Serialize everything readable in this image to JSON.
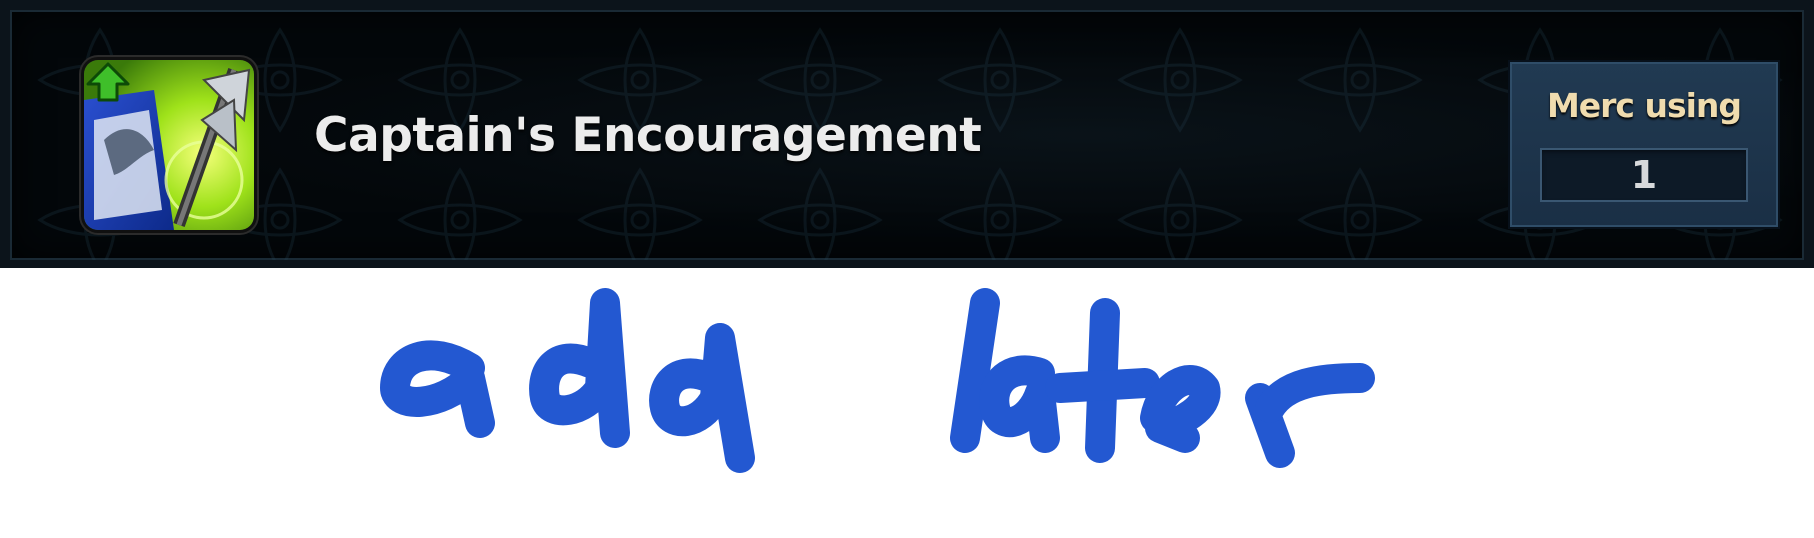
{
  "skill": {
    "name": "Captain's Encouragement",
    "icon": "war-banner-axe-icon",
    "upgrade_indicator": "green-up-arrow-icon"
  },
  "merc_panel": {
    "label": "Merc using",
    "value": "1"
  },
  "annotation": {
    "text": "add later",
    "color": "#2358d1"
  },
  "colors": {
    "banner_background": "#03070a",
    "panel_background": "#1a2f45",
    "label_gold": "#f0dcae"
  }
}
